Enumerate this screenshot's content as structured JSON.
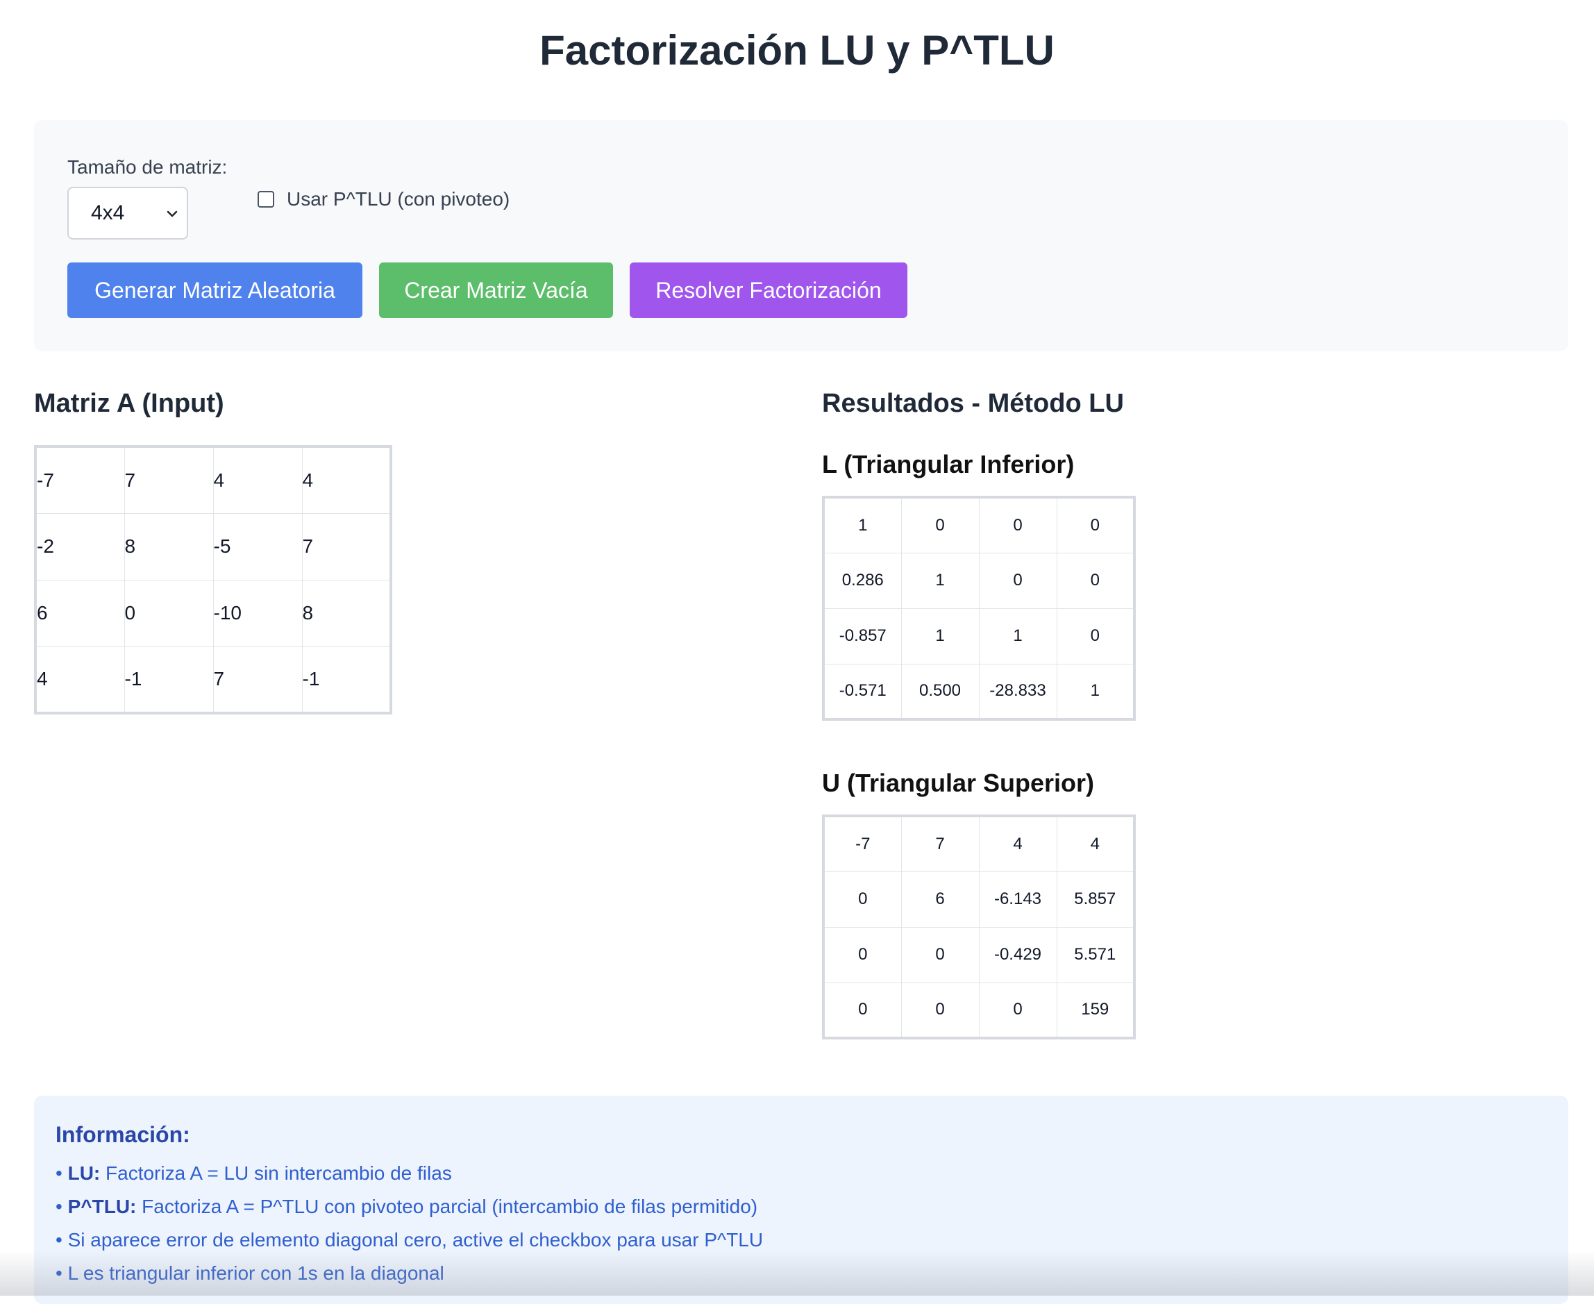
{
  "header": {
    "title": "Factorización LU y P^TLU"
  },
  "controls": {
    "size_label": "Tamaño de matriz:",
    "size_value": "4x4",
    "pivot_label": "Usar P^TLU (con pivoteo)",
    "pivot_checked": false,
    "buttons": {
      "random": "Generar Matriz Aleatoria",
      "empty": "Crear Matriz Vacía",
      "solve": "Resolver Factorización"
    }
  },
  "input": {
    "title": "Matriz A (Input)",
    "matrix": [
      [
        "-7",
        "7",
        "4",
        "4"
      ],
      [
        "-2",
        "8",
        "-5",
        "7"
      ],
      [
        "6",
        "0",
        "-10",
        "8"
      ],
      [
        "4",
        "-1",
        "7",
        "-1"
      ]
    ]
  },
  "results": {
    "title": "Resultados - Método LU",
    "L": {
      "title": "L (Triangular Inferior)",
      "matrix": [
        [
          "1",
          "0",
          "0",
          "0"
        ],
        [
          "0.286",
          "1",
          "0",
          "0"
        ],
        [
          "-0.857",
          "1",
          "1",
          "0"
        ],
        [
          "-0.571",
          "0.500",
          "-28.833",
          "1"
        ]
      ]
    },
    "U": {
      "title": "U (Triangular Superior)",
      "matrix": [
        [
          "-7",
          "7",
          "4",
          "4"
        ],
        [
          "0",
          "6",
          "-6.143",
          "5.857"
        ],
        [
          "0",
          "0",
          "-0.429",
          "5.571"
        ],
        [
          "0",
          "0",
          "0",
          "159"
        ]
      ]
    }
  },
  "info": {
    "title": "Información:",
    "items": [
      {
        "label": "LU:",
        "text": " Factoriza A = LU sin intercambio de filas"
      },
      {
        "label": "P^TLU:",
        "text": " Factoriza A = P^TLU con pivoteo parcial (intercambio de filas permitido)"
      },
      {
        "label": "",
        "text": "Si aparece error de elemento diagonal cero, active el checkbox para usar P^TLU"
      },
      {
        "label": "",
        "text": "L es triangular inferior con 1s en la diagonal"
      }
    ]
  }
}
